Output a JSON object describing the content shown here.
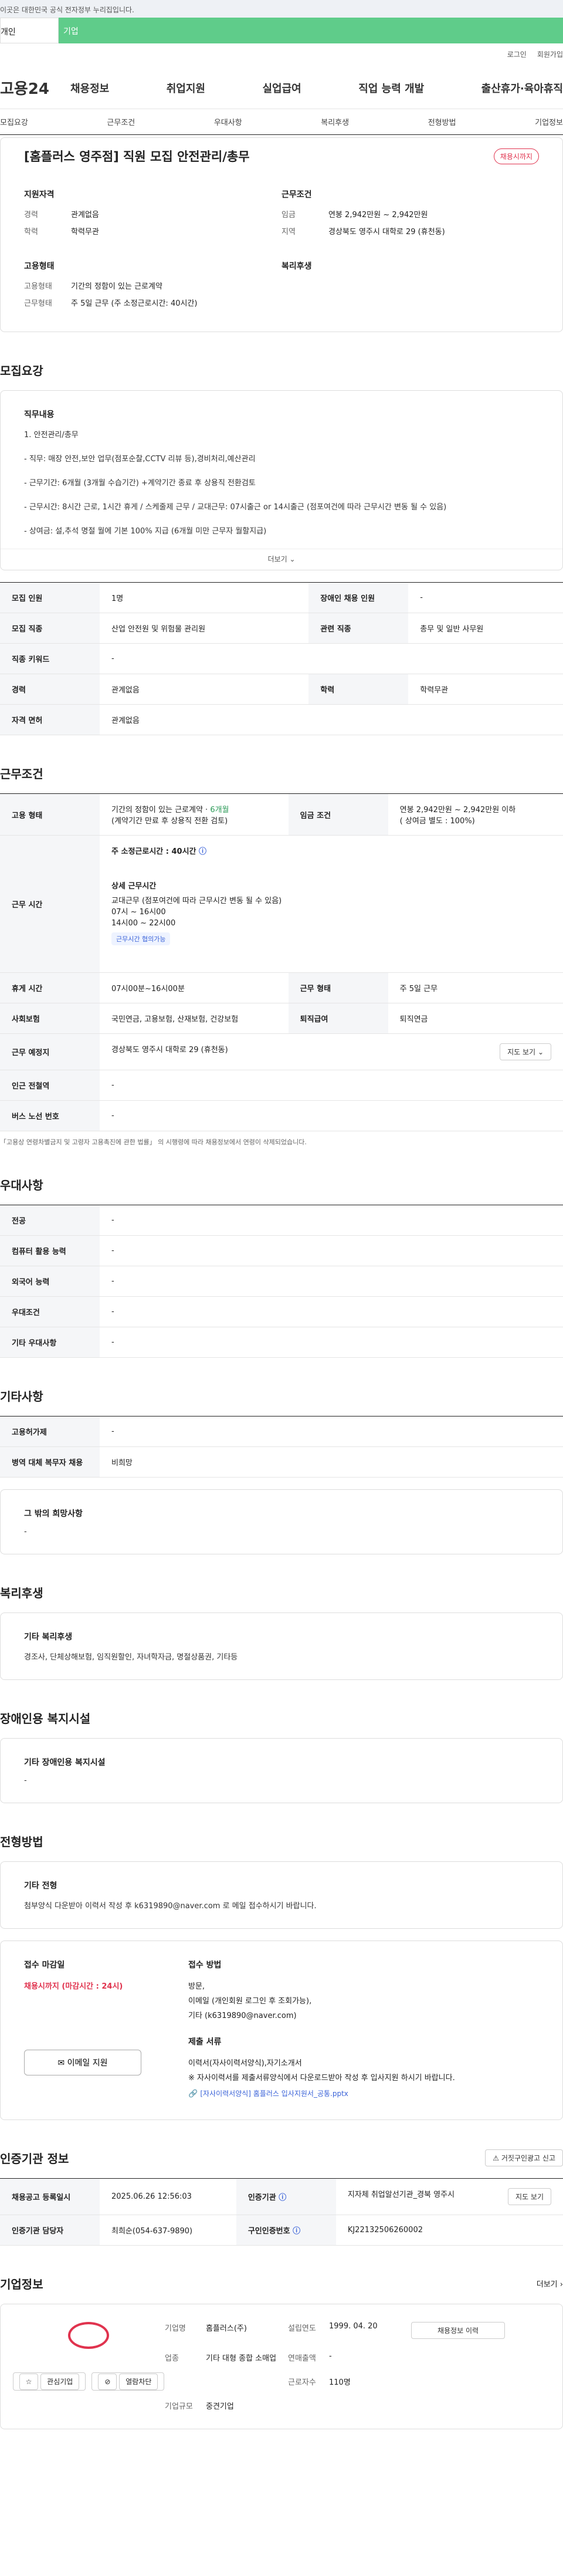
{
  "gov_banner": "이곳은 대한민국 공식 전자정부 누리집입니다.",
  "top_tabs": {
    "personal": "개인",
    "company": "기업"
  },
  "util": {
    "login": "로그인",
    "signup": "회원가입"
  },
  "logo": "고용24",
  "gnb": [
    "채용정보",
    "취업지원",
    "실업급여",
    "직업 능력 개발",
    "출산휴가·육아휴직"
  ],
  "anchors": [
    "모집요강",
    "근무조건",
    "우대사항",
    "복리후생",
    "전형방법",
    "기업정보"
  ],
  "job": {
    "title": "[홈플러스 영주점] 직원 모집 안전관리/총무",
    "badge": "채용시까지",
    "qual_title": "지원자격",
    "career_k": "경력",
    "career_v": "관계없음",
    "edu_k": "학력",
    "edu_v": "학력무관",
    "cond_title": "근무조건",
    "wage_k": "임금",
    "wage_v": "연봉 2,942만원 ~ 2,942만원",
    "region_k": "지역",
    "region_v": "경상북도 영주시 대학로 29 (휴천동)",
    "emp_title": "고용형태",
    "emp_type_k": "고용형태",
    "emp_type_v": "기간의 정함이 있는 근로계약",
    "work_k": "근무형태",
    "work_v": "주 5일 근무 (주 소정근로시간: 40시간)",
    "welfare_title": "복리후생"
  },
  "recruit": {
    "section": "모집요강",
    "detail_title": "직무내용",
    "lines": [
      "1. 안전관리/총무",
      "- 직무: 매장 안전,보안 업무(점포순찰,CCTV 리뷰 등),경비처리,예산관리",
      "- 근무기간: 6개월 (3개월 수습기간) +계약기간 종료 후 상용직 전환검토",
      "- 근무시간: 8시간 근로, 1시간 휴게 / 스케줄제 근무 / 교대근무: 07시출근 or 14시출근 (점포여건에 따라 근무시간 변동 될 수 있음)",
      "- 상여금: 설,추석 명절 월에 기본 100% 지급 (6개월 미만 근무자 월할지급)"
    ],
    "more": "더보기",
    "table": [
      [
        "모집 인원",
        "1명",
        "장애인 채용 인원",
        "-"
      ],
      [
        "모집 직종",
        "산업 안전원 및 위험물 관리원",
        "관련 직종",
        "총무 및 일반 사무원"
      ],
      [
        "직종 키워드",
        "-",
        "",
        ""
      ],
      [
        "경력",
        "관계없음",
        "학력",
        "학력무관"
      ],
      [
        "자격 면허",
        "관계없음",
        "",
        ""
      ]
    ]
  },
  "conditions": {
    "section": "근무조건",
    "emp_k": "고용 형태",
    "emp_v1": "기간의 정함이 있는 근로계약 · ",
    "emp_v_green": "6개월",
    "emp_v2": "(계약기간 만료 후 상용직 전환 검토)",
    "wage_k": "임금 조건",
    "wage_v1": "연봉 2,942만원 ~ 2,942만원 이하",
    "wage_v2": "( 상여금 별도 : 100%)",
    "hours_k": "근무 시간",
    "hours_main": "주 소정근로시간 : 40시간",
    "hours_detail_title": "상세 근무시간",
    "hours_lines": [
      "교대근무 (점포여건에 따라 근무시간 변동 될 수 있음)",
      "07시 ~ 16시00",
      "14시00 ~ 22시00"
    ],
    "hours_chip": "근무시간 협의가능",
    "break_k": "휴게 시간",
    "break_v": "07시00분~16시00분",
    "worktype_k": "근무 형태",
    "worktype_v": "주 5일 근무",
    "ins_k": "사회보험",
    "ins_v": "국민연금, 고용보험, 산재보험, 건강보험",
    "retire_k": "퇴직급여",
    "retire_v": "퇴직연금",
    "place_k": "근무 예정지",
    "place_v": "경상북도 영주시 대학로 29 (휴천동)",
    "map_btn": "지도 보기",
    "subway_k": "인근 전철역",
    "subway_v": "-",
    "bus_k": "버스 노선 번호",
    "bus_v": "-",
    "note": "「고용상 연령차별금지 및 고령자 고용촉진에 관한 법률」 의 시행령에 따라 채용정보에서 연령이 삭제되었습니다."
  },
  "prefer": {
    "section": "우대사항",
    "rows": [
      [
        "전공",
        "-"
      ],
      [
        "컴퓨터 활용 능력",
        "-"
      ],
      [
        "외국어 능력",
        "-"
      ],
      [
        "우대조건",
        "-"
      ],
      [
        "기타 우대사항",
        "-"
      ]
    ]
  },
  "other": {
    "section": "기타사항",
    "rows": [
      [
        "고용허가제",
        "-"
      ],
      [
        "병역 대체 복무자 채용",
        "비희망"
      ]
    ],
    "wish_title": "그 밖의 희망사항",
    "wish_v": "-"
  },
  "welfare": {
    "section": "복리후생",
    "title": "기타 복리후생",
    "value": "경조사, 단체상해보험, 임직원할인, 자녀학자금, 명절상품권, 기타등"
  },
  "disability": {
    "section": "장애인용 복지시설",
    "title": "기타 장애인용 복지시설",
    "value": "-"
  },
  "selection": {
    "section": "전형방법",
    "title": "기타 전형",
    "value": "첨부양식 다운받아 이력서 작성 후 k6319890@naver.com 로 메일 접수하시기 바랍니다.",
    "deadline_title": "접수 마감일",
    "deadline_value": "채용시까지 (마감시간 : 24시)",
    "method_title": "접수 방법",
    "methods": [
      "방문,",
      "이메일 (개인회원 로그인 후 조회가능),",
      "기타 (k6319890@naver.com)"
    ],
    "docs_title": "제출 서류",
    "docs": [
      "이력서(자사이력서양식),자기소개서",
      "※ 자사이력서를 제출서류양식에서 다운로드받아 작성 후 입사지원 하시기 바랍니다."
    ],
    "file": "[자사이력서양식] 홈플러스 입사지원서_공통.pptx",
    "email_btn": "이메일 지원"
  },
  "agency": {
    "section": "인증기관 정보",
    "report_btn": "거짓구인광고 신고",
    "reg_k": "채용공고 등록일시",
    "reg_v": "2025.06.26 12:56:03",
    "org_k": "인증기관",
    "org_v": "지자체 취업알선기관_경북 영주시",
    "map_btn": "지도 보기",
    "mgr_k": "인증기관 담당자",
    "mgr_v": "최희순(054-637-9890)",
    "id_k": "구인인증번호",
    "id_v": "KJ22132506260002"
  },
  "company": {
    "section": "기업정보",
    "more": "더보기",
    "fav": "관심기업",
    "block": "열람차단",
    "info_btn": "채용정보 이력",
    "name_k": "기업명",
    "name_v": "홈플러스(주)",
    "est_k": "설립연도",
    "est_v": "1999. 04. 20",
    "ind_k": "업종",
    "ind_v": "기타 대형 종합 소매업",
    "sales_k": "연매출액",
    "sales_v": "-",
    "emp_k": "근로자수",
    "emp_v": "110명",
    "size_k": "기업규모",
    "size_v": "중견기업"
  }
}
